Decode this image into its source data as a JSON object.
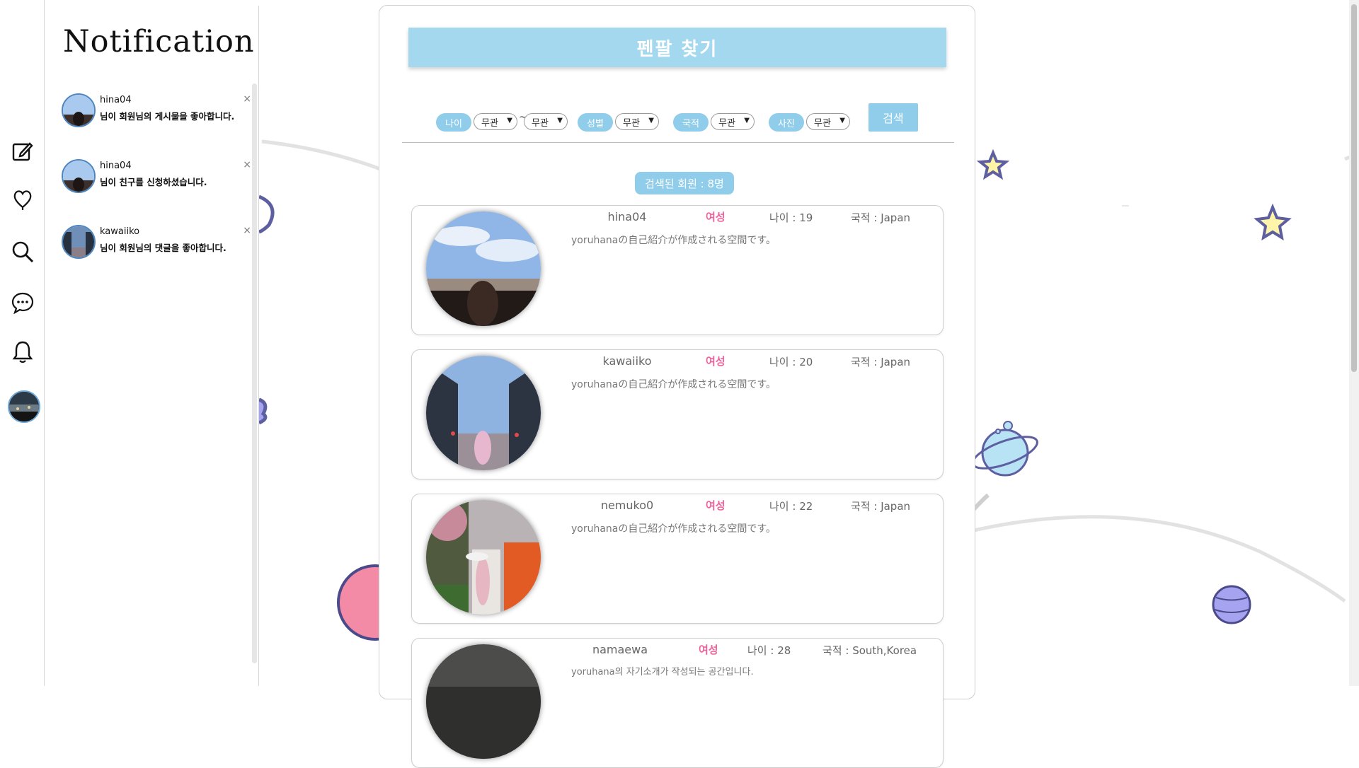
{
  "sidebar": {
    "icons": [
      "edit-icon",
      "heart-icon",
      "search-icon",
      "chat-icon",
      "bell-icon"
    ]
  },
  "notifications": {
    "title": "Notification",
    "items": [
      {
        "user": "hina04",
        "message": "님이 회원님의 게시물을 좋아합니다.",
        "close": "×"
      },
      {
        "user": "hina04",
        "message": "님이 친구를 신청하셨습니다.",
        "close": "×"
      },
      {
        "user": "kawaiiko",
        "message": "님이 회원님의 댓글을 좋아합니다.",
        "close": "×"
      }
    ]
  },
  "main": {
    "title": "펜팔 찾기",
    "filters": {
      "age_label": "나이",
      "age_from": "무관",
      "age_sep": "~",
      "age_to": "무관",
      "gender_label": "성별",
      "gender_value": "무관",
      "nationality_label": "국적",
      "nationality_value": "무관",
      "photo_label": "사진",
      "photo_value": "무관",
      "search_button": "검색"
    },
    "result_count": "검색된 회원 : 8명",
    "members": [
      {
        "name": "hina04",
        "gender": "여성",
        "age": "나이 : 19",
        "nationality": "국적 : Japan",
        "intro": "yoruhanaの自己紹介が作成される空間です。"
      },
      {
        "name": "kawaiiko",
        "gender": "여성",
        "age": "나이 : 20",
        "nationality": "국적 : Japan",
        "intro": "yoruhanaの自己紹介が作成される空間です。"
      },
      {
        "name": "nemuko0",
        "gender": "여성",
        "age": "나이 : 22",
        "nationality": "국적 : Japan",
        "intro": "yoruhanaの自己紹介が作成される空間です。"
      },
      {
        "name": "namaewa",
        "gender": "여성",
        "age": "나이 : 28",
        "nationality": "국적 : South,Korea",
        "intro": "yoruhana의 자기소개가 작성되는 공간입니다."
      }
    ]
  },
  "colors": {
    "accent": "#8fcdea",
    "header": "#a4d8ee",
    "female": "#f0629c"
  }
}
